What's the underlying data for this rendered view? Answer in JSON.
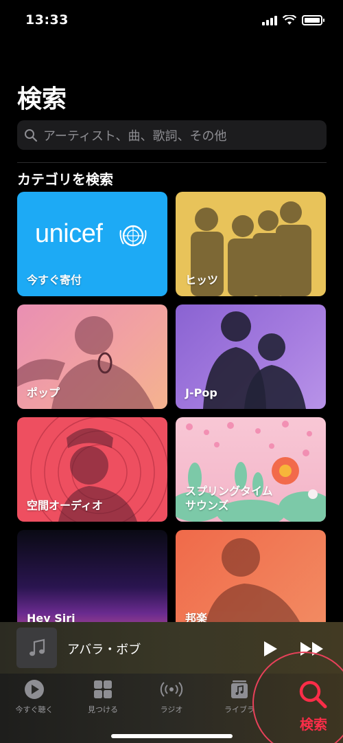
{
  "status": {
    "time": "13:33"
  },
  "header": {
    "title": "検索"
  },
  "search": {
    "placeholder": "アーティスト、曲、歌詞、その他"
  },
  "categories": {
    "title": "カテゴリを検索",
    "items": [
      {
        "label": "今すぐ寄付",
        "logo": "unicef"
      },
      {
        "label": "ヒッツ"
      },
      {
        "label": "ポップ"
      },
      {
        "label": "J-Pop"
      },
      {
        "label": "空間オーディオ"
      },
      {
        "label": "スプリングタイム\nサウンズ"
      },
      {
        "label": "Hey Siri"
      },
      {
        "label": "邦楽"
      }
    ]
  },
  "mini_player": {
    "title": "アバラ・ボブ",
    "play_icon": "play-icon",
    "forward_icon": "fast-forward-icon"
  },
  "tabs": [
    {
      "label": "今すぐ聴く",
      "icon": "play-circle-icon"
    },
    {
      "label": "見つける",
      "icon": "grid-icon"
    },
    {
      "label": "ラジオ",
      "icon": "radio-icon"
    },
    {
      "label": "ライブラ",
      "icon": "library-icon"
    },
    {
      "label": "検索",
      "icon": "search-icon",
      "active": true
    }
  ],
  "colors": {
    "accent": "#fa2d48",
    "background": "#000000",
    "search_field": "#1c1c1e"
  }
}
